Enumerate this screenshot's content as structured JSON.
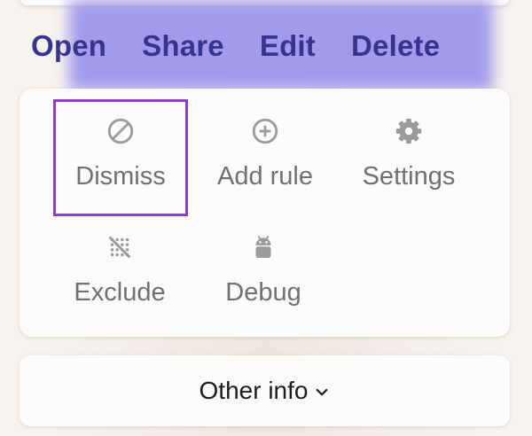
{
  "actions": {
    "open": "Open",
    "share": "Share",
    "edit": "Edit",
    "delete": "Delete"
  },
  "menu": {
    "items": [
      {
        "label": "Dismiss",
        "icon": "block-icon"
      },
      {
        "label": "Add rule",
        "icon": "add-circle-icon"
      },
      {
        "label": "Settings",
        "icon": "gear-icon"
      },
      {
        "label": "Exclude",
        "icon": "grid-off-icon"
      },
      {
        "label": "Debug",
        "icon": "android-icon"
      }
    ]
  },
  "footer": {
    "other_info": "Other info",
    "icon": "chevron-down-icon"
  },
  "colors": {
    "action_text": "#36348f",
    "highlight": "#8c82eb",
    "focus_outline": "#8f3fc4",
    "menu_label": "#707070",
    "icon": "#9a9a9a"
  }
}
